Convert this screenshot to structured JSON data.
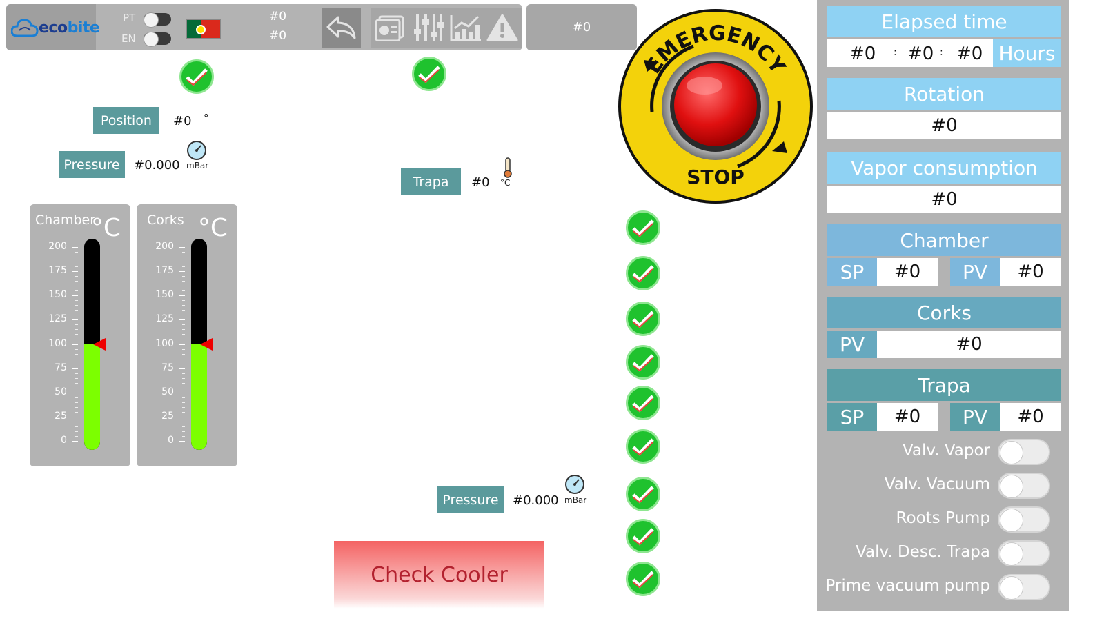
{
  "app": {
    "logo_prefix": "eco",
    "logo_suffix": "bite"
  },
  "topbar": {
    "lang_pt": "PT",
    "lang_en": "EN",
    "value1": "#0",
    "value2": "#0",
    "box2": "#0",
    "buttons": [
      "back-arrow-icon",
      "dashboard-icon",
      "sliders-icon",
      "chart-icon",
      "warning-icon"
    ]
  },
  "position": {
    "label": "Position",
    "value": "#0",
    "unit": "°"
  },
  "pressure_top": {
    "label": "Pressure",
    "value": "#0.000",
    "unit": "mBar"
  },
  "trapa": {
    "label": "Trapa",
    "value": "#0",
    "unit": "°C"
  },
  "pressure_bottom": {
    "label": "Pressure",
    "value": "#0.000",
    "unit": "mBar"
  },
  "thermometers": [
    {
      "title": "Chamber",
      "unit": "°C",
      "ticks": [
        "200",
        "175",
        "150",
        "125",
        "100",
        "75",
        "50",
        "25",
        "0"
      ],
      "level": 100,
      "setpoint": 100,
      "max": 200
    },
    {
      "title": "Corks",
      "unit": "°C",
      "ticks": [
        "200",
        "175",
        "150",
        "125",
        "100",
        "75",
        "50",
        "25",
        "0"
      ],
      "level": 100,
      "setpoint": 100,
      "max": 200
    }
  ],
  "emergency": {
    "top": "EMERGENCY",
    "bottom": "STOP"
  },
  "cooler_button": "Check Cooler",
  "right_panel": {
    "elapsed": {
      "title": "Elapsed time",
      "h": "#0",
      "m": "#0",
      "s": "#0",
      "sep": ":",
      "unit": "Hours"
    },
    "rotation": {
      "title": "Rotation",
      "value": "#0"
    },
    "vapor": {
      "title": "Vapor consumption",
      "value": "#0"
    },
    "chamber": {
      "title": "Chamber",
      "sp_label": "SP",
      "sp": "#0",
      "pv_label": "PV",
      "pv": "#0"
    },
    "corks": {
      "title": "Corks",
      "pv_label": "PV",
      "pv": "#0"
    },
    "trapa": {
      "title": "Trapa",
      "sp_label": "SP",
      "sp": "#0",
      "pv_label": "PV",
      "pv": "#0"
    },
    "switches": [
      "Valv. Vapor",
      "Valv. Vacuum",
      "Roots Pump",
      "Valv. Desc. Trapa",
      "Prime vacuum pump"
    ]
  },
  "colors": {
    "teal": "#5b9a9c",
    "light_blue": "#8fd2f3",
    "green": "#1fc22e",
    "panel_grey": "#b3b3b3"
  }
}
